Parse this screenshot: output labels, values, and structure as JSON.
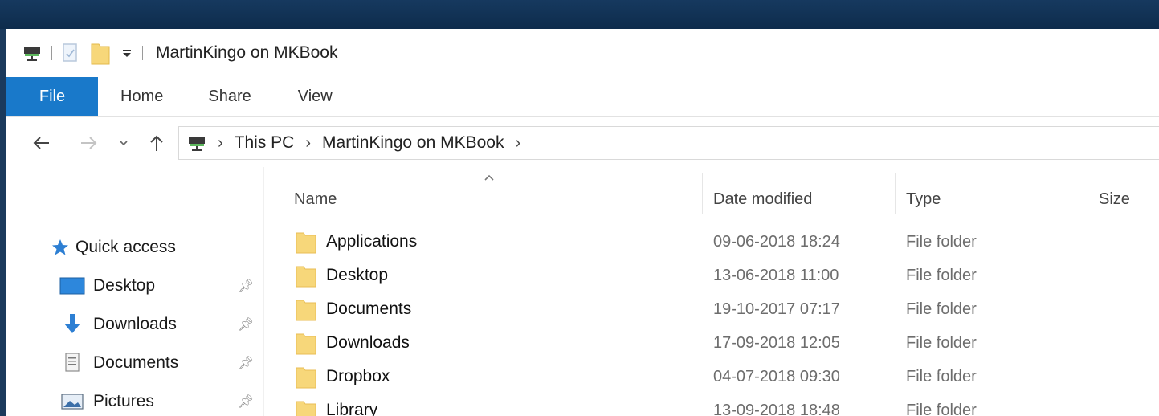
{
  "window": {
    "title": "MartinKingo on MKBook"
  },
  "ribbon": {
    "tabs": [
      {
        "label": "File"
      },
      {
        "label": "Home"
      },
      {
        "label": "Share"
      },
      {
        "label": "View"
      }
    ]
  },
  "address": {
    "crumbs": [
      {
        "label": "This PC"
      },
      {
        "label": "MartinKingo on MKBook"
      }
    ]
  },
  "navpane": {
    "quick_access": "Quick access",
    "items": [
      {
        "label": "Desktop",
        "icon": "desktop-icon",
        "pinned": true
      },
      {
        "label": "Downloads",
        "icon": "download-arrow-icon",
        "pinned": true
      },
      {
        "label": "Documents",
        "icon": "document-icon",
        "pinned": true
      },
      {
        "label": "Pictures",
        "icon": "pictures-icon",
        "pinned": true
      }
    ]
  },
  "columns": {
    "name": "Name",
    "date": "Date modified",
    "type": "Type",
    "size": "Size"
  },
  "files": [
    {
      "name": "Applications",
      "date": "09-06-2018 18:24",
      "type": "File folder"
    },
    {
      "name": "Desktop",
      "date": "13-06-2018 11:00",
      "type": "File folder"
    },
    {
      "name": "Documents",
      "date": "19-10-2017 07:17",
      "type": "File folder"
    },
    {
      "name": "Downloads",
      "date": "17-09-2018 12:05",
      "type": "File folder"
    },
    {
      "name": "Dropbox",
      "date": "04-07-2018 09:30",
      "type": "File folder"
    },
    {
      "name": "Library",
      "date": "13-09-2018 18:48",
      "type": "File folder"
    }
  ],
  "colors": {
    "file_tab": "#1979ca",
    "folder": "#f7d77a",
    "accent_blue": "#2d7fd3"
  }
}
